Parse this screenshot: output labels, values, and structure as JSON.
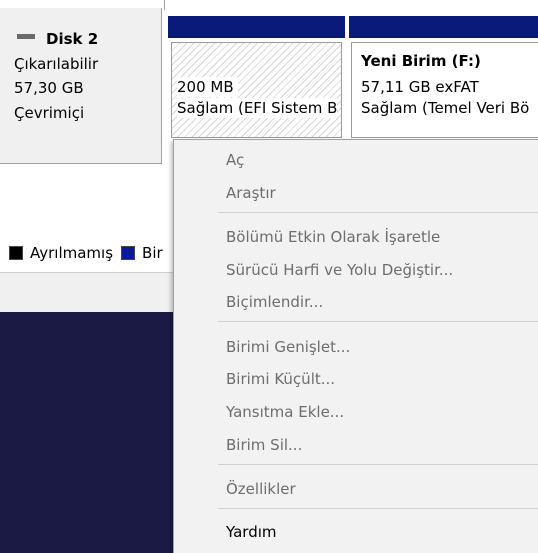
{
  "disk": {
    "title": "Disk 2",
    "type": "Çıkarılabilir",
    "size": "57,30 GB",
    "status": "Çevrimiçi"
  },
  "partitions": [
    {
      "size": "200 MB",
      "status": "Sağlam (EFI Sistem B"
    },
    {
      "name": "Yeni Birim  (F:)",
      "size_fs": "57,11 GB exFAT",
      "status": "Sağlam (Temel Veri Bö"
    }
  ],
  "legend": {
    "unallocated": "Ayrılmamış",
    "primary": "Bir"
  },
  "menu": {
    "items": [
      {
        "label": "Aç",
        "enabled": false
      },
      {
        "label": "Araştır",
        "enabled": false
      },
      {
        "label": "Bölümü Etkin Olarak İşaretle",
        "enabled": false
      },
      {
        "label": "Sürücü Harfi ve Yolu Değiştir...",
        "enabled": false
      },
      {
        "label": "Biçimlendir...",
        "enabled": false
      },
      {
        "label": "Birimi Genişlet...",
        "enabled": false
      },
      {
        "label": "Birimi Küçült...",
        "enabled": false
      },
      {
        "label": "Yansıtma Ekle...",
        "enabled": false
      },
      {
        "label": "Birim Sil...",
        "enabled": false
      },
      {
        "label": "Özellikler",
        "enabled": false
      },
      {
        "label": "Yardım",
        "enabled": true
      }
    ]
  },
  "colors": {
    "partition_bar": "#0a1a7a",
    "desktop_bg": "#1b1a45",
    "menu_bg": "#f2f2f2",
    "disabled_text": "#6d6d6d"
  }
}
